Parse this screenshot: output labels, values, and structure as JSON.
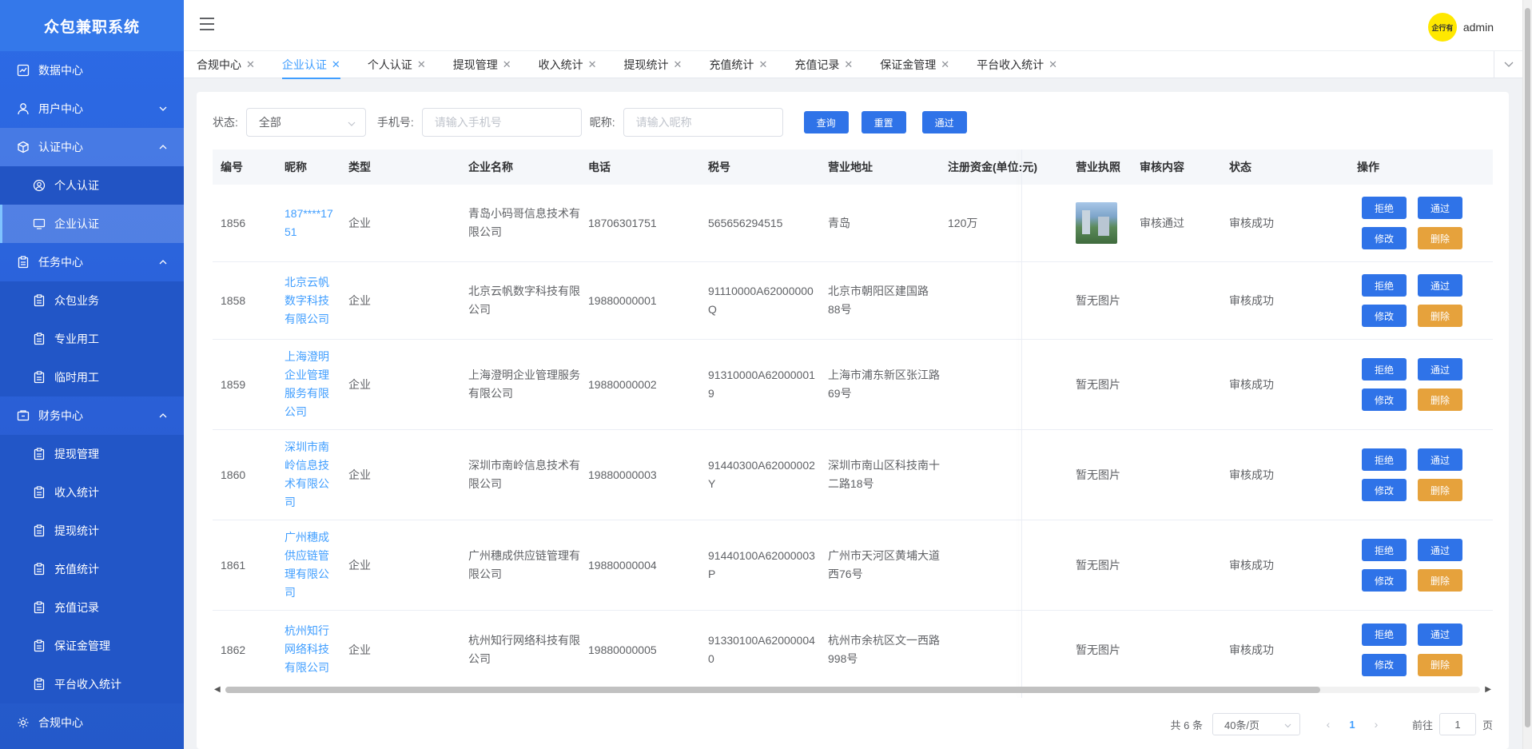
{
  "app": {
    "title": "众包兼职系统"
  },
  "sidebar": {
    "items": [
      {
        "label": "数据中心"
      },
      {
        "label": "用户中心"
      },
      {
        "label": "认证中心"
      },
      {
        "label": "个人认证"
      },
      {
        "label": "企业认证"
      },
      {
        "label": "任务中心"
      },
      {
        "label": "众包业务"
      },
      {
        "label": "专业用工"
      },
      {
        "label": "临时用工"
      },
      {
        "label": "财务中心"
      },
      {
        "label": "提现管理"
      },
      {
        "label": "收入统计"
      },
      {
        "label": "提现统计"
      },
      {
        "label": "充值统计"
      },
      {
        "label": "充值记录"
      },
      {
        "label": "保证金管理"
      },
      {
        "label": "平台收入统计"
      },
      {
        "label": "合规中心"
      }
    ]
  },
  "header": {
    "username": "admin",
    "avatar_text": "企行有"
  },
  "tabs": [
    {
      "label": "合规中心"
    },
    {
      "label": "企业认证"
    },
    {
      "label": "个人认证"
    },
    {
      "label": "提现管理"
    },
    {
      "label": "收入统计"
    },
    {
      "label": "提现统计"
    },
    {
      "label": "充值统计"
    },
    {
      "label": "充值记录"
    },
    {
      "label": "保证金管理"
    },
    {
      "label": "平台收入统计"
    }
  ],
  "filters": {
    "status_label": "状态:",
    "status_value": "全部",
    "phone_label": "手机号:",
    "phone_placeholder": "请输入手机号",
    "nickname_label": "昵称:",
    "nickname_placeholder": "请输入昵称",
    "query_button": "查询",
    "reset_button": "重置",
    "approve_button": "通过"
  },
  "table": {
    "headers": {
      "id": "编号",
      "nickname": "昵称",
      "type": "类型",
      "company": "企业名称",
      "phone": "电话",
      "tax": "税号",
      "address": "营业地址",
      "capital": "注册资金(单位:元)",
      "license": "营业执照",
      "audit": "审核内容",
      "status": "状态",
      "ops": "操作"
    },
    "op_labels": {
      "reject": "拒绝",
      "approve": "通过",
      "edit": "修改",
      "delete": "删除"
    },
    "rows": [
      {
        "id": "1856",
        "nickname": "187****1751",
        "type": "企业",
        "company": "青岛小码哥信息技术有限公司",
        "phone": "18706301751",
        "tax": "565656294515",
        "address": "青岛",
        "capital": "120万",
        "license": "",
        "audit": "审核通过",
        "status": "审核成功"
      },
      {
        "id": "1858",
        "nickname": "北京云帆数字科技有限公司",
        "type": "企业",
        "company": "北京云帆数字科技有限公司",
        "phone": "19880000001",
        "tax": "91110000A62000000Q",
        "address": "北京市朝阳区建国路88号",
        "capital": "",
        "license": "暂无图片",
        "audit": "",
        "status": "审核成功"
      },
      {
        "id": "1859",
        "nickname": "上海澄明企业管理服务有限公司",
        "type": "企业",
        "company": "上海澄明企业管理服务有限公司",
        "phone": "19880000002",
        "tax": "91310000A620000019",
        "address": "上海市浦东新区张江路69号",
        "capital": "",
        "license": "暂无图片",
        "audit": "",
        "status": "审核成功"
      },
      {
        "id": "1860",
        "nickname": "深圳市南岭信息技术有限公司",
        "type": "企业",
        "company": "深圳市南岭信息技术有限公司",
        "phone": "19880000003",
        "tax": "91440300A62000002Y",
        "address": "深圳市南山区科技南十二路18号",
        "capital": "",
        "license": "暂无图片",
        "audit": "",
        "status": "审核成功"
      },
      {
        "id": "1861",
        "nickname": "广州穗成供应链管理有限公司",
        "type": "企业",
        "company": "广州穗成供应链管理有限公司",
        "phone": "19880000004",
        "tax": "91440100A62000003P",
        "address": "广州市天河区黄埔大道西76号",
        "capital": "",
        "license": "暂无图片",
        "audit": "",
        "status": "审核成功"
      },
      {
        "id": "1862",
        "nickname": "杭州知行网络科技有限公司",
        "type": "企业",
        "company": "杭州知行网络科技有限公司",
        "phone": "19880000005",
        "tax": "91330100A620000040",
        "address": "杭州市余杭区文一西路998号",
        "capital": "",
        "license": "暂无图片",
        "audit": "",
        "status": "审核成功"
      }
    ]
  },
  "pagination": {
    "total": "共 6 条",
    "page_size": "40条/页",
    "current_page": "1",
    "goto_label": "前往",
    "goto_value": "1",
    "page_unit": "页"
  }
}
